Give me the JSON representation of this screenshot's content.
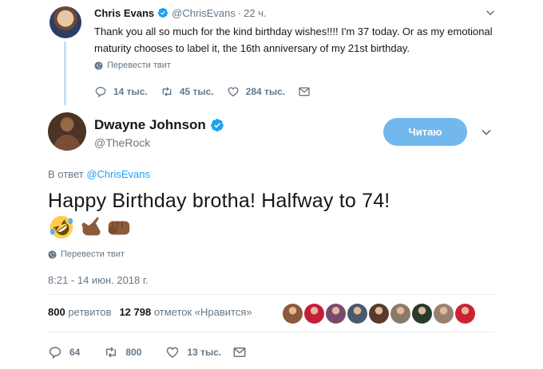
{
  "parent_tweet": {
    "name": "Chris Evans",
    "handle": "@ChrisEvans",
    "separator": "·",
    "time": "22 ч.",
    "text": "Thank you all so much for the kind birthday wishes!!!! I'm 37 today. Or as my emotional maturity chooses to label it, the 16th anniversary of my 21st birthday.",
    "translate_label": "Перевести твит",
    "actions": {
      "replies": "14 тыс.",
      "retweets": "45 тыс.",
      "likes": "284 тыс."
    }
  },
  "main_tweet": {
    "name": "Dwayne Johnson",
    "handle": "@TheRock",
    "follow_button": "Читаю",
    "reply_prefix": "В ответ",
    "reply_to": "@ChrisEvans",
    "text": "Happy Birthday brotha! Halfway to 74!",
    "emojis": [
      "rolling-on-floor-laughing",
      "call-me-hand",
      "oncoming-fist"
    ],
    "translate_label": "Перевести твит",
    "timestamp": "8:21 - 14 июн. 2018 г.",
    "stats": {
      "retweets_count": "800",
      "retweets_label": "ретвитов",
      "likes_count": "12 798",
      "likes_label": "отметок «Нравится»"
    },
    "liker_colors": [
      "#8b5a3c",
      "#c41e3a",
      "#7a4a6b",
      "#4a5a6a",
      "#5a3a2a",
      "#8a7a6a",
      "#2a3a2a",
      "#9a8070",
      "#cc2233"
    ],
    "actions": {
      "replies": "64",
      "retweets": "800",
      "likes": "13 тыс."
    }
  },
  "colors": {
    "accent": "#1da1f2",
    "follow_button_bg": "#73b8ec",
    "muted_text": "#657786",
    "thread_line": "#c4e0f5"
  }
}
